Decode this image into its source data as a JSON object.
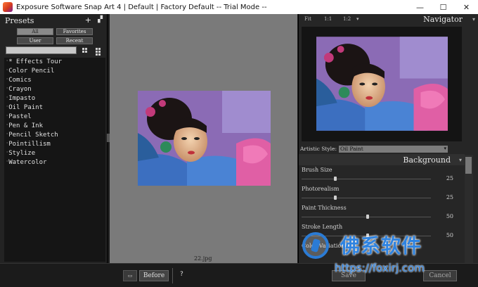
{
  "window": {
    "title": "Exposure Software Snap Art 4 | Default | Factory Default -- Trial Mode --",
    "controls": [
      "—",
      "☐",
      "✕"
    ]
  },
  "presets": {
    "title": "Presets",
    "add_icon": "+",
    "filters": [
      "All",
      "Favorites",
      "User",
      "Recent"
    ],
    "active_filter": "All",
    "items": [
      "* Effects Tour",
      "Color Pencil",
      "Comics",
      "Crayon",
      "Impasto",
      "Oil Paint",
      "Pastel",
      "Pen & Ink",
      "Pencil Sketch",
      "Pointillism",
      "Stylize",
      "Watercolor"
    ]
  },
  "canvas": {
    "filename": "22.jpg"
  },
  "navigator": {
    "title": "Navigator",
    "zoom_options": [
      "Fit",
      "1:1",
      "1:2"
    ]
  },
  "style": {
    "label": "Artistic Style:",
    "selected": "Oil Paint"
  },
  "background": {
    "title": "Background",
    "params": [
      {
        "label": "Brush Size",
        "value": "25",
        "level": 0.25
      },
      {
        "label": "Photorealism",
        "value": "25",
        "level": 0.25
      },
      {
        "label": "Paint Thickness",
        "value": "50",
        "level": 0.5
      },
      {
        "label": "Stroke Length",
        "value": "50",
        "level": 0.5
      }
    ],
    "partial_label": "Color Variation"
  },
  "bottom": {
    "view_label": "▭",
    "before_label": "Before",
    "help_label": "?",
    "save_label": "Save",
    "cancel_label": "Cancel"
  },
  "watermark": {
    "cn": "佛系软件",
    "url": "https://foxirj.com"
  },
  "colors": {
    "panel_dark": "#232323",
    "canvas_gray": "#7a7a7a",
    "accent_blue": "#2f83e0"
  }
}
